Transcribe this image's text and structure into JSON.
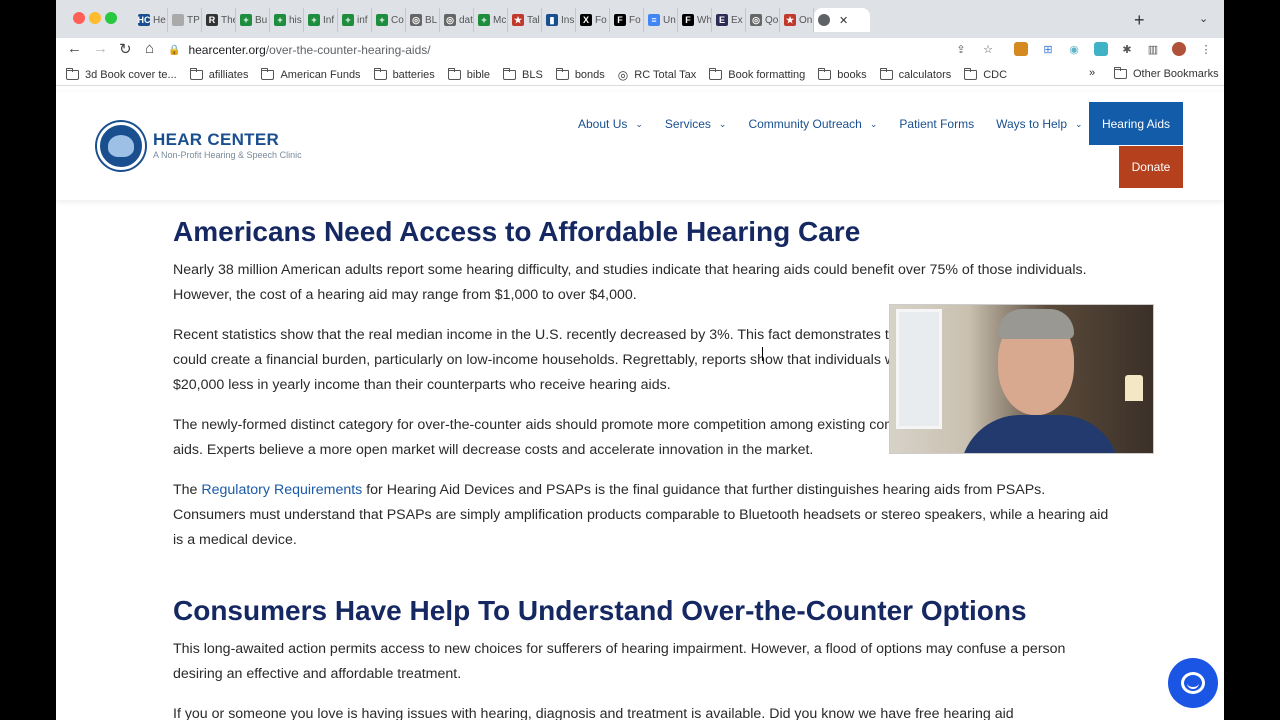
{
  "browser": {
    "tabs": [
      {
        "label": "He",
        "icon": "hc-icon",
        "color": "#1a4f8f",
        "glyph": "HC"
      },
      {
        "label": "TP",
        "icon": "tp-icon",
        "color": "#aaaaaa",
        "glyph": ""
      },
      {
        "label": "The",
        "icon": "r-icon",
        "color": "#333333",
        "glyph": "R"
      },
      {
        "label": "Bu",
        "icon": "sheets-icon",
        "color": "#1e8e3e",
        "glyph": "+"
      },
      {
        "label": "his",
        "icon": "sheets-icon",
        "color": "#1e8e3e",
        "glyph": "+"
      },
      {
        "label": "Inf",
        "icon": "sheets-icon",
        "color": "#1e8e3e",
        "glyph": "+"
      },
      {
        "label": "inf",
        "icon": "sheets-icon",
        "color": "#1e8e3e",
        "glyph": "+"
      },
      {
        "label": "Co",
        "icon": "sheets-icon",
        "color": "#1e8e3e",
        "glyph": "+"
      },
      {
        "label": "BL",
        "icon": "globe-icon",
        "color": "#666666",
        "glyph": "◎"
      },
      {
        "label": "dat",
        "icon": "globe-icon",
        "color": "#666666",
        "glyph": "◎"
      },
      {
        "label": "Mc",
        "icon": "sheets-icon",
        "color": "#1e8e3e",
        "glyph": "+"
      },
      {
        "label": "Tal",
        "icon": "star-icon",
        "color": "#c0392b",
        "glyph": "★"
      },
      {
        "label": "Ins",
        "icon": "chart-icon",
        "color": "#1a4f8f",
        "glyph": "▮"
      },
      {
        "label": "Fo",
        "icon": "x-icon",
        "color": "#000000",
        "glyph": "X"
      },
      {
        "label": "Fo",
        "icon": "f-icon",
        "color": "#000000",
        "glyph": "F"
      },
      {
        "label": "Un",
        "icon": "docs-icon",
        "color": "#4285f4",
        "glyph": "≡"
      },
      {
        "label": "Wh",
        "icon": "f-icon",
        "color": "#000000",
        "glyph": "F"
      },
      {
        "label": "Ex",
        "icon": "ex-icon",
        "color": "#2c2c54",
        "glyph": "E"
      },
      {
        "label": "Qo",
        "icon": "globe-icon",
        "color": "#666666",
        "glyph": "◎"
      },
      {
        "label": "On",
        "icon": "star-icon",
        "color": "#c0392b",
        "glyph": "★"
      }
    ],
    "url_host": "hearcenter.org",
    "url_path": "/over-the-counter-hearing-aids/",
    "bookmarks": [
      {
        "label": "3d Book cover te..."
      },
      {
        "label": "afilliates"
      },
      {
        "label": "American Funds"
      },
      {
        "label": "batteries"
      },
      {
        "label": "bible"
      },
      {
        "label": "BLS"
      },
      {
        "label": "bonds"
      },
      {
        "label": "RC Total Tax"
      },
      {
        "label": "Book formatting"
      },
      {
        "label": "books"
      },
      {
        "label": "calculators"
      },
      {
        "label": "CDC"
      }
    ],
    "more_bookmarks": "»",
    "other_bookmarks": "Other Bookmarks"
  },
  "site": {
    "logo_title": "HEAR CENTER",
    "logo_subtitle": "A Non-Profit Hearing & Speech Clinic",
    "nav": [
      {
        "label": "About Us",
        "dropdown": true
      },
      {
        "label": "Services",
        "dropdown": true
      },
      {
        "label": "Community Outreach",
        "dropdown": true
      },
      {
        "label": "Patient Forms",
        "dropdown": false
      },
      {
        "label": "Ways to Help",
        "dropdown": true
      }
    ],
    "hearing_aids_button": "Hearing Aids",
    "donate_button": "Donate"
  },
  "article": {
    "heading1": "Americans Need Access to Affordable Hearing Care",
    "p1": "Nearly 38 million American adults report some hearing difficulty, and studies indicate that hearing aids could benefit over 75% of those individuals. However, the cost of a hearing aid may range from $1,000 to over $4,000.",
    "p2": "Recent statistics show that the real median income in the U.S. recently decreased by 3%. This fact demonstrates that the high cost of hearing aids could create a financial burden, particularly on low-income households. Regrettably, reports show that individuals with unaided hearing loss average $20,000 less in yearly income than their counterparts who receive hearing aids.",
    "p3": "The newly-formed distinct category for over-the-counter aids should promote more competition among existing companies that manufacture hearing aids. Experts believe a more open market will decrease costs and accelerate innovation in the market.",
    "p4_prefix": "The ",
    "p4_link": "Regulatory Requirements",
    "p4_rest": " for Hearing Aid Devices and PSAPs is the final guidance that further distinguishes hearing aids from PSAPs. Consumers must understand that PSAPs are simply amplification products comparable to Bluetooth headsets or stereo speakers, while a hearing aid is a medical device.",
    "heading2": "Consumers Have Help To Understand Over-the-Counter Options",
    "p5": "This long-awaited action permits access to new choices for sufferers of hearing impairment. However, a flood of options may confuse a person desiring an effective and affordable treatment.",
    "p6": "If you or someone you love is having issues with hearing, diagnosis and treatment is available. Did you know we have free hearing aid"
  },
  "colors": {
    "heading": "#152862",
    "nav": "#1a4f8f",
    "hearing_aids_bg": "#135ca9",
    "donate_bg": "#b5401e",
    "chat_bg": "#1a55e3"
  }
}
